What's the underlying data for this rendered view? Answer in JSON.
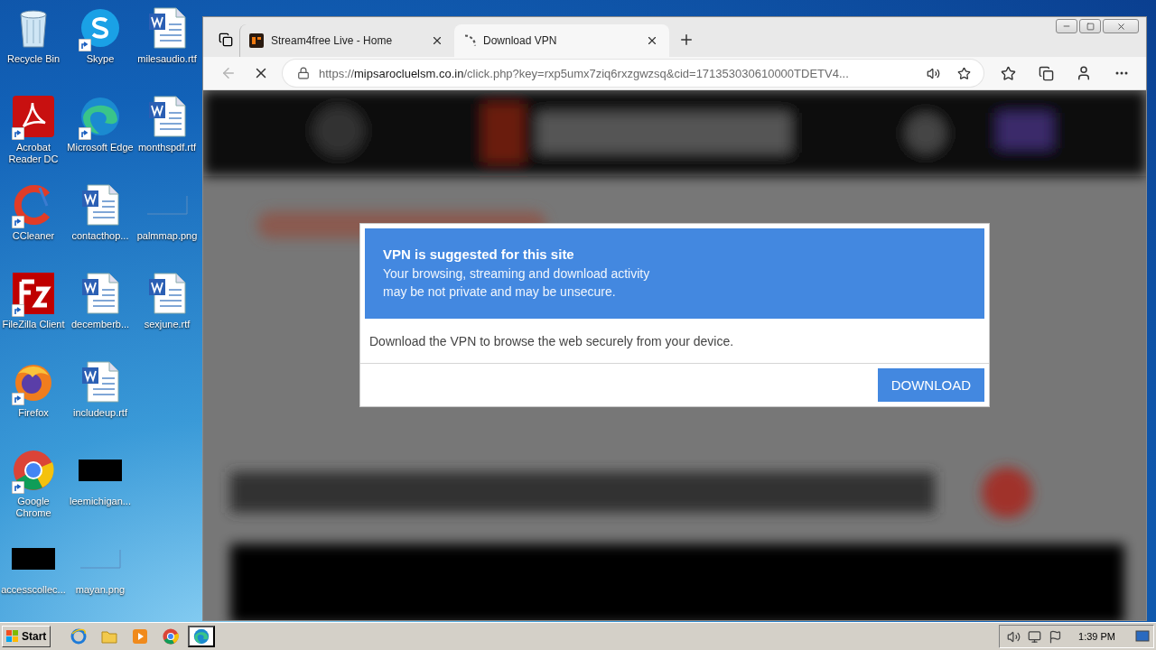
{
  "desktop_icons": [
    {
      "label": "Recycle Bin",
      "kind": "recycle",
      "shortcut": false
    },
    {
      "label": "Acrobat Reader DC",
      "kind": "pdf",
      "shortcut": true
    },
    {
      "label": "CCleaner",
      "kind": "ccleaner",
      "shortcut": true
    },
    {
      "label": "FileZilla Client",
      "kind": "filezilla",
      "shortcut": true
    },
    {
      "label": "Firefox",
      "kind": "firefox",
      "shortcut": true
    },
    {
      "label": "Google Chrome",
      "kind": "chrome",
      "shortcut": true
    },
    {
      "label": "accesscollec...",
      "kind": "black",
      "shortcut": false
    },
    {
      "label": "Skype",
      "kind": "skype",
      "shortcut": true
    },
    {
      "label": "Microsoft Edge",
      "kind": "edge",
      "shortcut": true
    },
    {
      "label": "contacthop...",
      "kind": "word",
      "shortcut": false
    },
    {
      "label": "decemberb...",
      "kind": "word",
      "shortcut": false
    },
    {
      "label": "includeup.rtf",
      "kind": "word",
      "shortcut": false
    },
    {
      "label": "leemichigan...",
      "kind": "black",
      "shortcut": false
    },
    {
      "label": "mayan.png",
      "kind": "blank",
      "shortcut": false
    },
    {
      "label": "milesaudio.rtf",
      "kind": "word",
      "shortcut": false
    },
    {
      "label": "monthspdf.rtf",
      "kind": "word",
      "shortcut": false
    },
    {
      "label": "palmmap.png",
      "kind": "blank",
      "shortcut": false
    },
    {
      "label": "sexjune.rtf",
      "kind": "word",
      "shortcut": false
    }
  ],
  "browser": {
    "tabs": [
      {
        "label": "Stream4free Live - Home",
        "kind": "site",
        "selected": false
      },
      {
        "label": "Download VPN",
        "kind": "loading",
        "selected": true
      }
    ],
    "back_disabled": true,
    "address": {
      "scheme": "https://",
      "host": "mipsarocluelsm.co.in",
      "path": "/click.php?key=rxp5umx7ziq6rxzgwzsq&cid=171353030610000TDETV4..."
    }
  },
  "dialog": {
    "title": "VPN is suggested for this site",
    "subtitle": "Your browsing, streaming and download activity may be not private and may be unsecure.",
    "message": "Download the VPN to browse the web securely from your device.",
    "button": "DOWNLOAD"
  },
  "taskbar": {
    "start": "Start",
    "apps": [
      {
        "kind": "ie",
        "selected": false
      },
      {
        "kind": "explorer",
        "selected": false
      },
      {
        "kind": "media",
        "selected": false
      },
      {
        "kind": "chrome",
        "selected": false
      },
      {
        "kind": "edge",
        "selected": true
      }
    ],
    "clock": "1:39 PM"
  }
}
